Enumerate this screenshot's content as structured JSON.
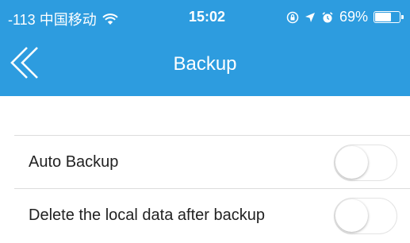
{
  "status_bar": {
    "carrier": "-113 中国移动",
    "time": "15:02",
    "battery": "69%",
    "battery_level": 0.69
  },
  "nav": {
    "back_icon": "double-chevron-left-icon",
    "title": "Backup"
  },
  "settings": [
    {
      "label": "Auto Backup",
      "enabled": false
    },
    {
      "label": "Delete the local data after backup",
      "enabled": false
    }
  ],
  "colors": {
    "accent": "#2d9cdf",
    "separator": "#dcdcdc"
  }
}
